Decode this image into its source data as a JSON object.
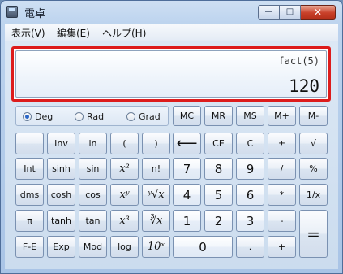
{
  "window": {
    "title": "電卓",
    "min_symbol": "—",
    "max_symbol": "□",
    "close_symbol": "✕"
  },
  "menu": [
    "表示(V)",
    "編集(E)",
    "ヘルプ(H)"
  ],
  "display": {
    "expression": "fact(5)",
    "value": "120"
  },
  "angle_modes": {
    "options": [
      "Deg",
      "Rad",
      "Grad"
    ],
    "selected": "Deg"
  },
  "keys": {
    "blank": "",
    "inv": "Inv",
    "ln": "ln",
    "lparen": "(",
    "rparen": ")",
    "mc": "MC",
    "mr": "MR",
    "ms": "MS",
    "mplus": "M+",
    "mminus": "M-",
    "backspace": "⟵",
    "ce": "CE",
    "c": "C",
    "plusminus": "±",
    "sqrt": "√",
    "int": "Int",
    "sinh": "sinh",
    "sin": "sin",
    "x2": "x²",
    "fact": "n!",
    "d7": "7",
    "d8": "8",
    "d9": "9",
    "div": "/",
    "pct": "%",
    "dms": "dms",
    "cosh": "cosh",
    "cos": "cos",
    "xy": "xʸ",
    "yroot": "ʸ√x",
    "d4": "4",
    "d5": "5",
    "d6": "6",
    "mul": "*",
    "recip": "1/x",
    "pi": "π",
    "tanh": "tanh",
    "tan": "tan",
    "x3": "x³",
    "cuberoot": "∛x",
    "d1": "1",
    "d2": "2",
    "d3": "3",
    "sub": "-",
    "eq": "=",
    "fe": "F-E",
    "exp": "Exp",
    "mod": "Mod",
    "log": "log",
    "tenx": "10ˣ",
    "d0": "0",
    "dot": ".",
    "add": "+"
  }
}
